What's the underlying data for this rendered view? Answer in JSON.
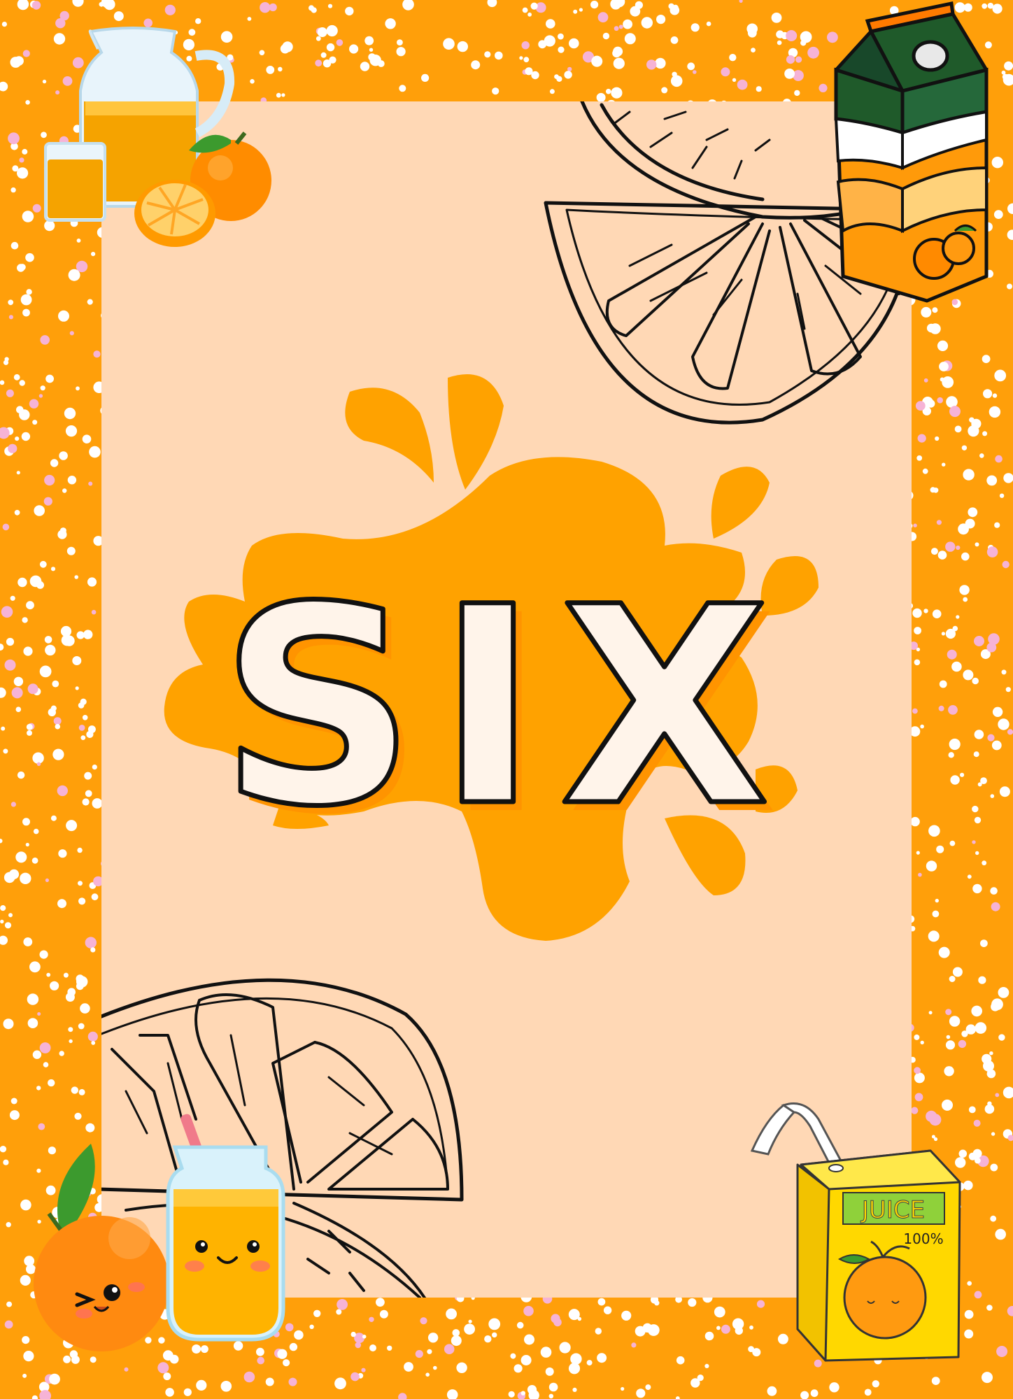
{
  "poster": {
    "word": "SIX",
    "colors": {
      "border": "#ff9f0a",
      "panel": "#ffd8b5",
      "splash": "#ffa200",
      "outline": "#111111",
      "dot_white": "#ffffff",
      "dot_pink": "#f6b3d6"
    }
  },
  "juice_box": {
    "brand_text": "JUICE",
    "percent_text": "100%"
  },
  "decorations": {
    "top_left": "juice-pitcher-with-oranges",
    "top_right": "juice-carton",
    "bottom_left": "kawaii-orange-and-juice-jar",
    "bottom_right": "juice-box-with-straw",
    "line_art": "orange-slice-outline"
  }
}
